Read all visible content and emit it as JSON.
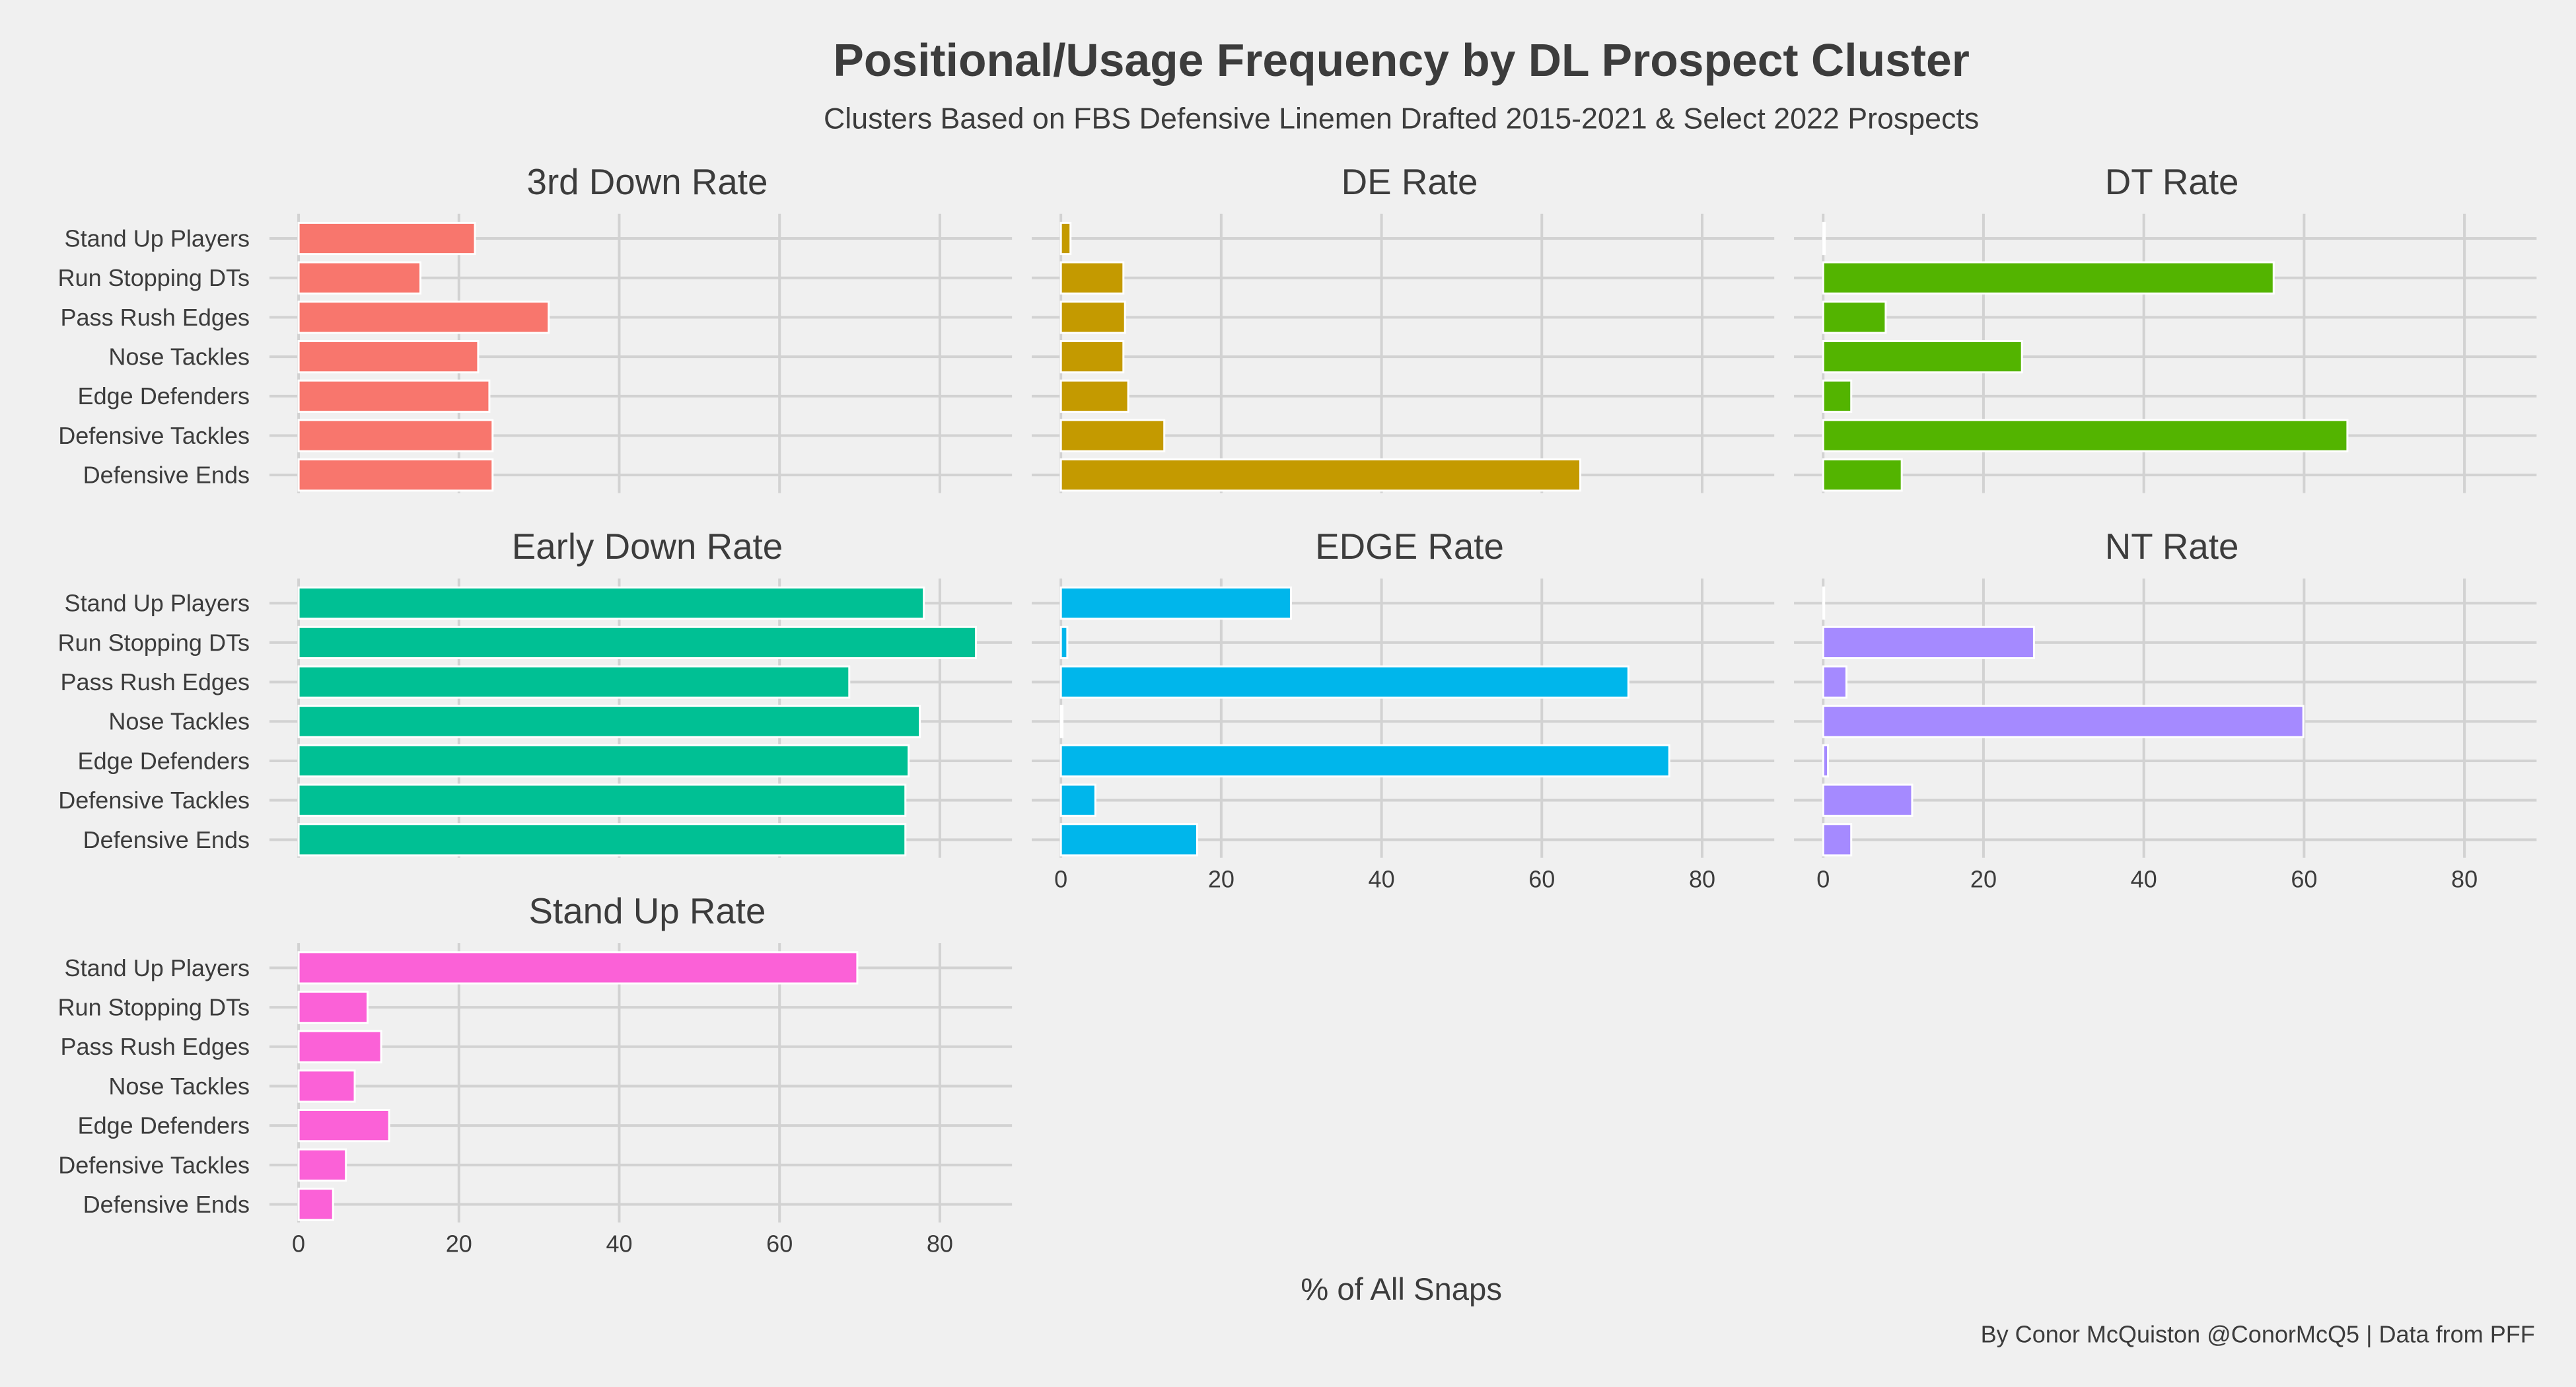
{
  "chart_data": {
    "type": "bar",
    "orientation": "horizontal",
    "title": "Positional/Usage Frequency by DL Prospect Cluster",
    "subtitle": "Clusters Based on FBS Defensive Linemen Drafted 2015-2021 & Select 2022 Prospects",
    "xlabel": "% of All Snaps",
    "ylabel": "",
    "caption": "By Conor McQuiston @ConorMcQ5 | Data from PFF",
    "xlim": [
      -2,
      89
    ],
    "xticks": [
      0,
      20,
      40,
      60,
      80
    ],
    "grid": true,
    "legend": "none",
    "categories": [
      "Stand Up Players",
      "Run Stopping DTs",
      "Pass Rush Edges",
      "Nose Tackles",
      "Edge Defenders",
      "Defensive Tackles",
      "Defensive Ends"
    ],
    "panels": [
      {
        "name": "3rd Down Rate",
        "color": "#f8766d",
        "values": [
          22.0,
          15.2,
          31.2,
          22.4,
          23.8,
          24.2,
          24.2
        ]
      },
      {
        "name": "DE Rate",
        "color": "#c49a00",
        "values": [
          1.2,
          7.8,
          8.0,
          7.8,
          8.4,
          12.9,
          64.8
        ]
      },
      {
        "name": "DT Rate",
        "color": "#53b400",
        "values": [
          0.2,
          56.2,
          7.8,
          24.8,
          3.5,
          65.4,
          9.8
        ]
      },
      {
        "name": "Early Down Rate",
        "color": "#00c094",
        "values": [
          78.0,
          84.5,
          68.7,
          77.5,
          76.1,
          75.7,
          75.7
        ]
      },
      {
        "name": "EDGE Rate",
        "color": "#00b6eb",
        "values": [
          28.7,
          0.8,
          70.8,
          0.2,
          75.9,
          4.3,
          17.0
        ]
      },
      {
        "name": "NT Rate",
        "color": "#a58aff",
        "values": [
          0.1,
          26.3,
          2.9,
          59.9,
          0.6,
          11.1,
          3.5
        ]
      },
      {
        "name": "Stand Up Rate",
        "color": "#fb61d7",
        "values": [
          69.7,
          8.6,
          10.3,
          7.0,
          11.3,
          5.9,
          4.3
        ]
      }
    ]
  }
}
